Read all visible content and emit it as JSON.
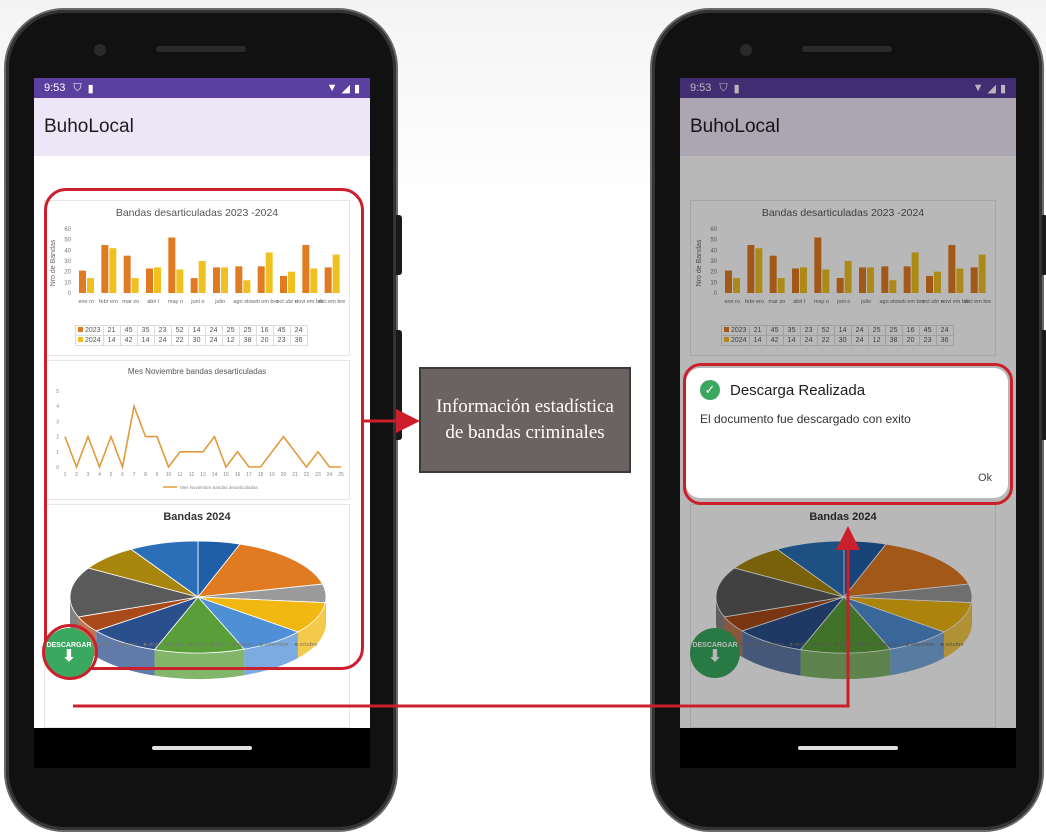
{
  "status": {
    "time": "9:53"
  },
  "app": {
    "title": "BuhoLocal"
  },
  "bar_chart": {
    "title": "Bandas desarticuladas 2023 -2024",
    "ylabel": "Nro de Bandas",
    "months": [
      "ene ro",
      "febr ero",
      "mar zo",
      "abri l",
      "may o",
      "juni o",
      "julio",
      "ago sto",
      "seti em bre",
      "oct ubr e",
      "novi em bre",
      "dici em bre"
    ],
    "series": [
      {
        "name": "2023",
        "color": "#e07b22",
        "values": [
          21,
          45,
          35,
          23,
          52,
          14,
          24,
          25,
          25,
          16,
          45,
          24
        ]
      },
      {
        "name": "2024",
        "color": "#f0c020",
        "values": [
          14,
          42,
          14,
          24,
          22,
          30,
          24,
          12,
          38,
          20,
          23,
          36
        ]
      }
    ],
    "yticks": [
      "60",
      "50",
      "40",
      "30",
      "20",
      "10",
      "0"
    ]
  },
  "line_chart": {
    "title": "Mes Noviembre bandas desarticuladas",
    "legend": "Mes Noviembre bandas desarticuladas",
    "x": [
      "1",
      "2",
      "3",
      "4",
      "5",
      "6",
      "7",
      "8",
      "9",
      "10",
      "11",
      "12",
      "13",
      "14",
      "15",
      "16",
      "17",
      "18",
      "19",
      "20",
      "21",
      "22",
      "23",
      "24",
      "25"
    ],
    "values": [
      2,
      0,
      2,
      0,
      2,
      0,
      4,
      2,
      2,
      0,
      1,
      1,
      1,
      2,
      0,
      1,
      0,
      0,
      1,
      2,
      1,
      0,
      1,
      0,
      0
    ],
    "yticks": [
      "5",
      "4",
      "3",
      "2",
      "1",
      "0"
    ]
  },
  "pie_chart": {
    "title": "Bandas 2024",
    "legend": [
      "enero",
      "febrero",
      "marzo",
      "abril",
      "mayo",
      "junio",
      "julio",
      "agosto",
      "setiembre",
      "octubre",
      "noviembre"
    ],
    "slices": [
      {
        "value": 14,
        "color": "#1f5fa8"
      },
      {
        "value": 42,
        "color": "#e07b22"
      },
      {
        "value": 14,
        "color": "#9a9a9a"
      },
      {
        "value": 24,
        "color": "#f0b810"
      },
      {
        "value": 22,
        "color": "#4f8fd6"
      },
      {
        "value": 30,
        "color": "#5a9e3a"
      },
      {
        "value": 24,
        "color": "#2b4f8c"
      },
      {
        "value": 12,
        "color": "#a84a1a"
      },
      {
        "value": 38,
        "color": "#5a5a5a"
      },
      {
        "value": 20,
        "color": "#a8860e"
      },
      {
        "value": 23,
        "color": "#2a6fb8"
      }
    ]
  },
  "fab": {
    "label": "DESCARGAR",
    "icon": "download-arrow-icon"
  },
  "callout": {
    "text": "Información estadística de bandas criminales"
  },
  "dialog": {
    "title": "Descarga Realizada",
    "message": "El documento fue descargado con exito",
    "ok": "Ok"
  },
  "colors": {
    "accent_red": "#cc1f2c",
    "status_purple": "#5b3f9e",
    "fab_green": "#3aa85f"
  }
}
